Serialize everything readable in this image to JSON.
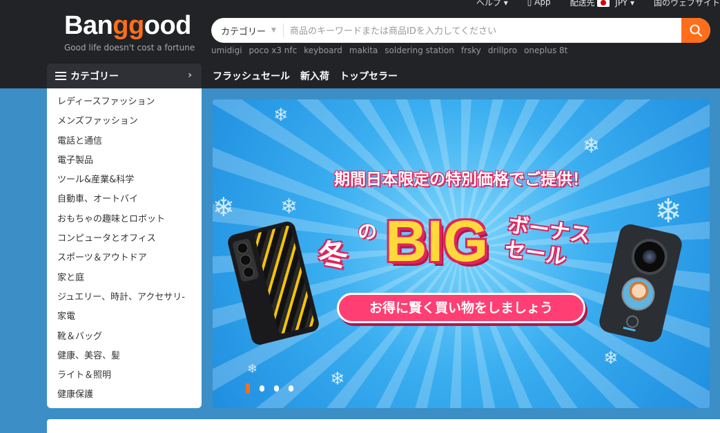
{
  "top_links": {
    "help": "ヘルプ ▾",
    "app": "App",
    "ship_to": "配送先",
    "currency": "JPY ▾",
    "account": "国のウェブサイト"
  },
  "logo": {
    "part1": "Ban",
    "part2": "gg",
    "part3": "ood",
    "tagline": "Good life doesn't cost a fortune"
  },
  "search": {
    "category": "カテゴリー",
    "placeholder": "商品のキーワードまたは商品IDを入力してください",
    "hot_keywords": [
      "umidigi",
      "poco x3 nfc",
      "keyboard",
      "makita",
      "soldering station",
      "frsky",
      "drillpro",
      "oneplus 8t"
    ]
  },
  "categories_header": "カテゴリー",
  "nav": [
    "フラッシュセール",
    "新入荷",
    "トップセラー"
  ],
  "categories": [
    "レディースファッション",
    "メンズファッション",
    "電話と通信",
    "電子製品",
    "ツール&産業&科学",
    "自動車、オートバイ",
    "おもちゃの趣味とロボット",
    "コンピュータとオフィス",
    "スポーツ＆アウトドア",
    "家と庭",
    "ジュエリー、時計、アクセサリ-",
    "家電",
    "靴＆バッグ",
    "健康、美容、髪",
    "ライト＆照明",
    "健康保護"
  ],
  "banner": {
    "subtitle": "期間日本限定の特別価格でご提供！",
    "word_winter": "冬",
    "word_no": "の",
    "word_big": "BIG",
    "word_bonus": "ボーナス\nセール",
    "pill": "お得に賢く買い物をしましょう",
    "slides": 4,
    "active_slide": 1
  },
  "colors": {
    "accent": "#ff6e1a",
    "header_bg": "#222326",
    "page_bg": "#3b8fc6",
    "banner_pink": "#e0245e",
    "banner_yellow": "#ffd93b"
  }
}
